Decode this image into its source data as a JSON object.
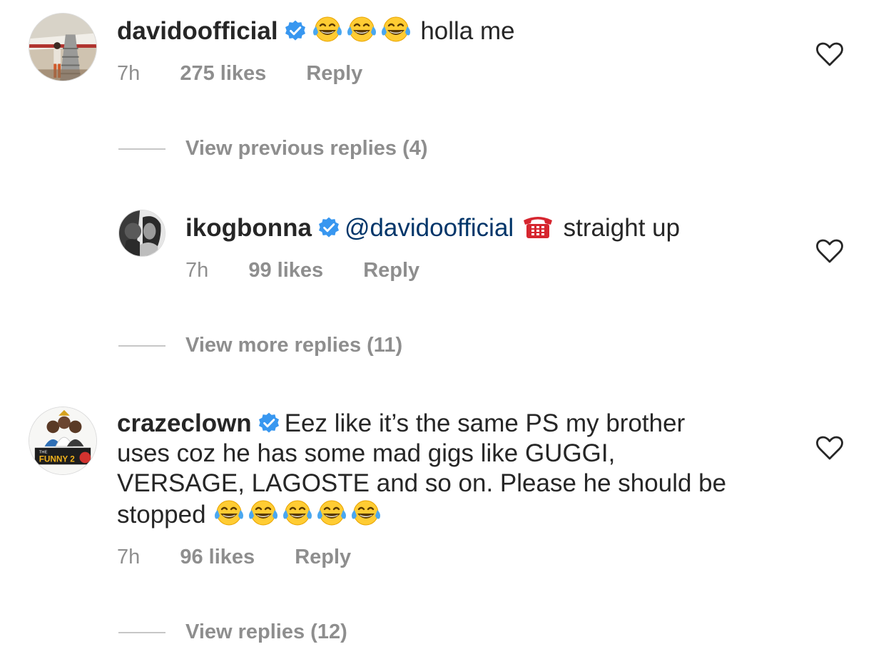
{
  "comments": [
    {
      "username": "davidoofficial",
      "verified": true,
      "text_suffix": "holla me",
      "time": "7h",
      "likes": "275 likes",
      "reply_label": "Reply",
      "view_replies": "View previous replies (4)"
    },
    {
      "username": "ikogbonna",
      "verified": true,
      "mention": "@davidoofficial",
      "text_suffix": "straight up",
      "time": "7h",
      "likes": "99 likes",
      "reply_label": "Reply",
      "view_replies": "View more replies (11)"
    },
    {
      "username": "crazeclown",
      "verified": true,
      "line1": "Eez like it’s the same PS my brother",
      "line2": "uses coz he has some mad gigs like GUGGI,",
      "line3": "VERSAGE, LAGOSTE and so on. Please he should be",
      "line4": "stopped",
      "avatar_text": "FUNNY 2",
      "time": "7h",
      "likes": "96 likes",
      "reply_label": "Reply",
      "view_replies": "View replies (12)"
    }
  ],
  "icons": {
    "verified": "verified-badge-icon",
    "laugh": "face-with-tears-of-joy-emoji",
    "phone": "telephone-emoji",
    "like": "heart-outline-icon"
  },
  "colors": {
    "verified": "#3897f0",
    "mention": "#003569",
    "secondary_text": "#8e8e8e",
    "primary_text": "#262626"
  }
}
